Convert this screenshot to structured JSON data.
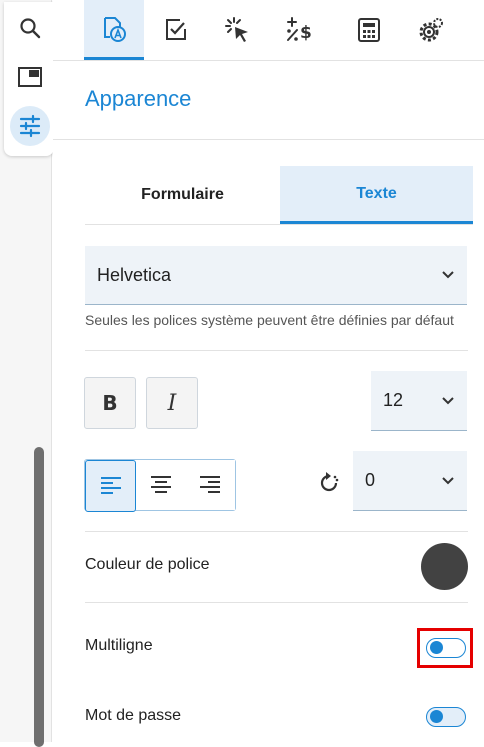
{
  "left_rail": {
    "items": [
      {
        "icon": "search-icon"
      },
      {
        "icon": "panel-icon"
      },
      {
        "icon": "sliders-icon",
        "active": true
      }
    ]
  },
  "top_tabs": [
    {
      "icon": "appearance-icon",
      "active": true
    },
    {
      "icon": "checkbox-icon"
    },
    {
      "icon": "cursor-click-icon"
    },
    {
      "icon": "calculation-icon"
    },
    {
      "icon": "calculator-icon"
    },
    {
      "icon": "settings-icon"
    }
  ],
  "panel": {
    "title": "Apparence",
    "subtabs": {
      "form": "Formulaire",
      "text": "Texte"
    },
    "font": {
      "value": "Helvetica",
      "hint": "Seules les polices système peuvent être définies par défaut"
    },
    "bold_label": "B",
    "italic_label": "I",
    "font_size": "12",
    "rotation": "0",
    "font_color_label": "Couleur de police",
    "font_color": "#424242",
    "multiline_label": "Multiligne",
    "password_label": "Mot de passe"
  },
  "colors": {
    "accent": "#1b86d4",
    "highlight": "#e50000"
  }
}
